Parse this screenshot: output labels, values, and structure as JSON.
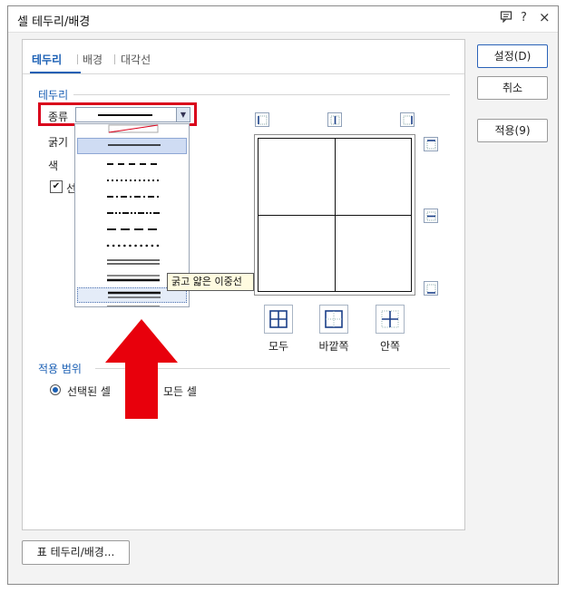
{
  "window": {
    "title": "셀 테두리/배경",
    "controls": {
      "help": "?",
      "close": "×"
    }
  },
  "tabs": [
    {
      "label": "테두리",
      "active": true
    },
    {
      "label": "배경",
      "active": false
    },
    {
      "label": "대각선",
      "active": false
    }
  ],
  "border_section": {
    "title": "테두리",
    "type_label": "종류",
    "thickness_label": "굵기",
    "color_label": "색",
    "checkbox_label_visible": "선",
    "checkbox_checked": true
  },
  "line_styles": [
    {
      "id": "none-diagonal",
      "selected": false,
      "hovered": false
    },
    {
      "id": "solid",
      "selected": true,
      "hovered": false
    },
    {
      "id": "dashed",
      "selected": false,
      "hovered": false
    },
    {
      "id": "dotted",
      "selected": false,
      "hovered": false
    },
    {
      "id": "dash-dot",
      "selected": false,
      "hovered": false
    },
    {
      "id": "dash-dot-dot",
      "selected": false,
      "hovered": false
    },
    {
      "id": "long-dash",
      "selected": false,
      "hovered": false
    },
    {
      "id": "round-dot",
      "selected": false,
      "hovered": false
    },
    {
      "id": "double",
      "selected": false,
      "hovered": false
    },
    {
      "id": "thin-thick-double",
      "selected": false,
      "hovered": false
    },
    {
      "id": "thick-thin-double",
      "selected": false,
      "hovered": true
    },
    {
      "id": "triple",
      "selected": false,
      "hovered": false
    }
  ],
  "tooltip": "굵고 얇은 이중선",
  "preset_buttons": [
    {
      "id": "all",
      "label": "모두"
    },
    {
      "id": "outer",
      "label": "바깥쪽"
    },
    {
      "id": "inner",
      "label": "안쪽"
    }
  ],
  "apply_section": {
    "title": "적용 범위",
    "options": [
      {
        "label": "선택된 셀",
        "checked": true
      },
      {
        "label": "모든 셀",
        "checked": false
      }
    ]
  },
  "side_buttons": {
    "ok": "설정(D)",
    "cancel": "취소",
    "apply": "적용(9)"
  },
  "bottom_button": "표 테두리/배경...",
  "colors": {
    "accent": "#1a5fb4",
    "highlight_red": "#d9001b",
    "arrow_red": "#e8000c"
  }
}
